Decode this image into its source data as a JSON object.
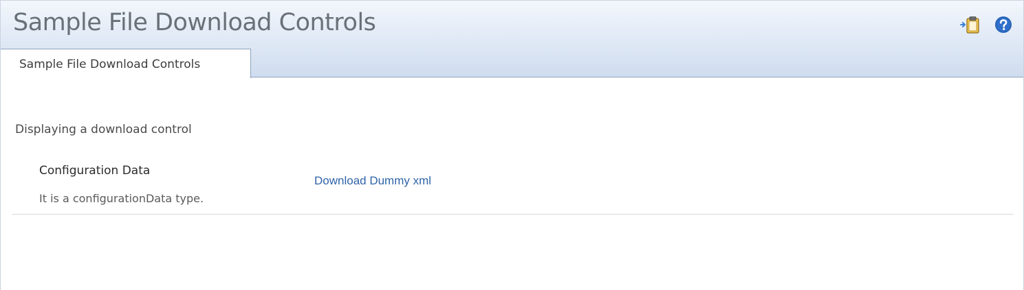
{
  "header": {
    "title": "Sample File Download Controls",
    "icons": [
      {
        "name": "add-to-clipboard-icon",
        "interactable": true
      },
      {
        "name": "help-icon",
        "interactable": true
      }
    ]
  },
  "tabs": [
    {
      "label": "Sample File Download Controls",
      "active": true
    }
  ],
  "content": {
    "section_heading": "Displaying a download control",
    "field": {
      "label": "Configuration Data",
      "description": "It is a configurationData type.",
      "link_text": "Download Dummy xml"
    }
  },
  "colors": {
    "header_gradient_top": "#f3f7fc",
    "header_gradient_bottom": "#cfdcef",
    "title_text": "#6a7078",
    "link": "#2f64a9",
    "help_icon": "#2a63b8",
    "clipboard_icon": "#d9a62e"
  }
}
